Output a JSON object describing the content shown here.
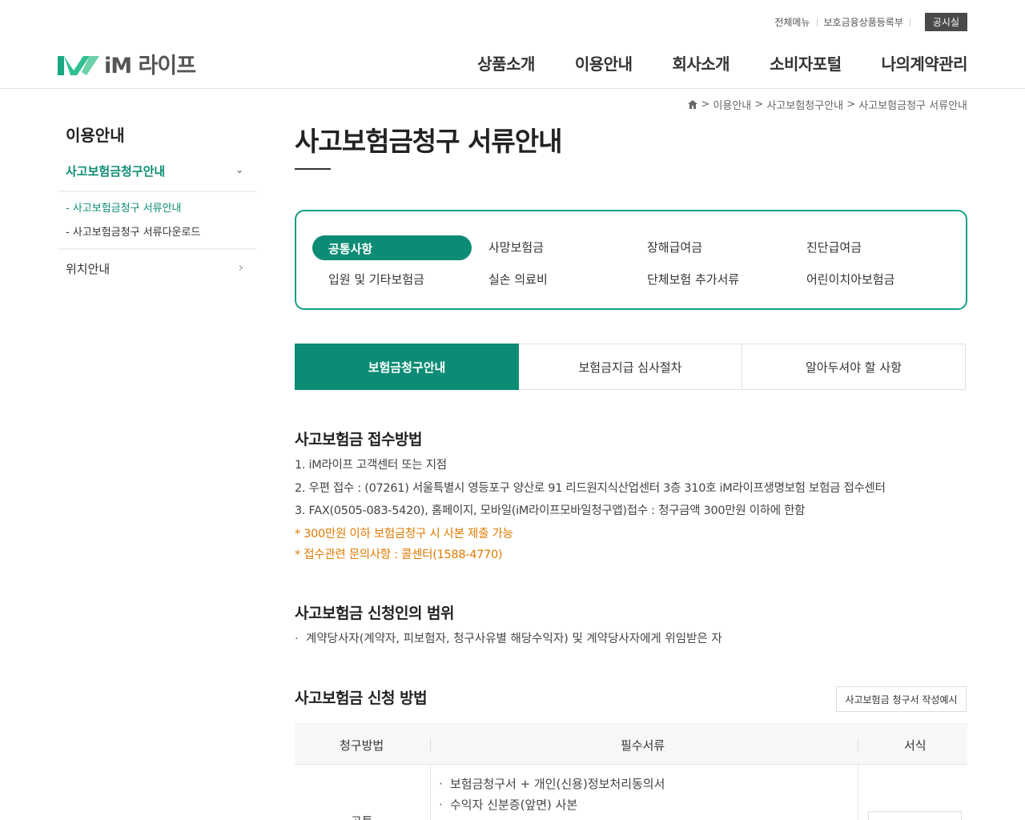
{
  "header": {
    "util_links": [
      "전체메뉴",
      "보호금융상품등록부"
    ],
    "notice_label": "공시실",
    "logo_text": "iM 라이프",
    "nav": [
      "상품소개",
      "이용안내",
      "회사소개",
      "소비자포털",
      "나의계약관리"
    ]
  },
  "sidebar": {
    "title": "이용안내",
    "menu1": "사고보험금청구안내",
    "sub": [
      "- 사고보험금청구 서류안내",
      "- 사고보험금청구 서류다운로드"
    ],
    "menu2": "위치안내"
  },
  "breadcrumb": [
    "이용안내",
    "사고보험청구안내",
    "사고보험금청구 서류안내"
  ],
  "page_title": "사고보험금청구 서류안내",
  "categories": [
    "공통사항",
    "사망보험금",
    "장해급여금",
    "진단급여금",
    "입원 및 기타보험금",
    "실손 의료비",
    "단체보험 추가서류",
    "어린이치아보험금"
  ],
  "tabs": [
    "보험금청구안내",
    "보험금지급 심사절차",
    "알아두셔야 할 사항"
  ],
  "section1": {
    "title": "사고보험금 접수방법",
    "lines": [
      "1. iM라이프 고객센터 또는 지점",
      "2. 우편 접수 : (07261) 서울특별시 영등포구 양산로 91 리드원지식산업센터 3층 310호 iM라이프생명보험 보험금 접수센터",
      "3. FAX(0505-083-5420), 홈페이지, 모바일(iM라이프모바일청구앱)접수 : 청구금액 300만원 이하에 한함"
    ],
    "notes": [
      "* 300만원 이하 보험금청구 시 사본 제출 가능",
      "* 접수관련 문의사항 : 콜센터(1588-4770)"
    ]
  },
  "section2": {
    "title": "사고보험금 신청인의 범위",
    "bullet": "계약당사자(계약자, 피보험자, 청구사유별 해당수익자) 및 계약당사자에게 위임받은 자"
  },
  "section3": {
    "title": "사고보험금 신청 방법",
    "example_button": "사고보험금 청구서 작성예시",
    "table_headers": [
      "청구방법",
      "필수서류",
      "서식"
    ],
    "rows_visible": [
      "보험금청구서 + 개인(신용)정보처리동의서",
      "수익자 신분증(앞면) 사본"
    ],
    "row_left_partial": "공통"
  },
  "colors": {
    "accent": "#0c8c74",
    "orange": "#e07a00"
  }
}
